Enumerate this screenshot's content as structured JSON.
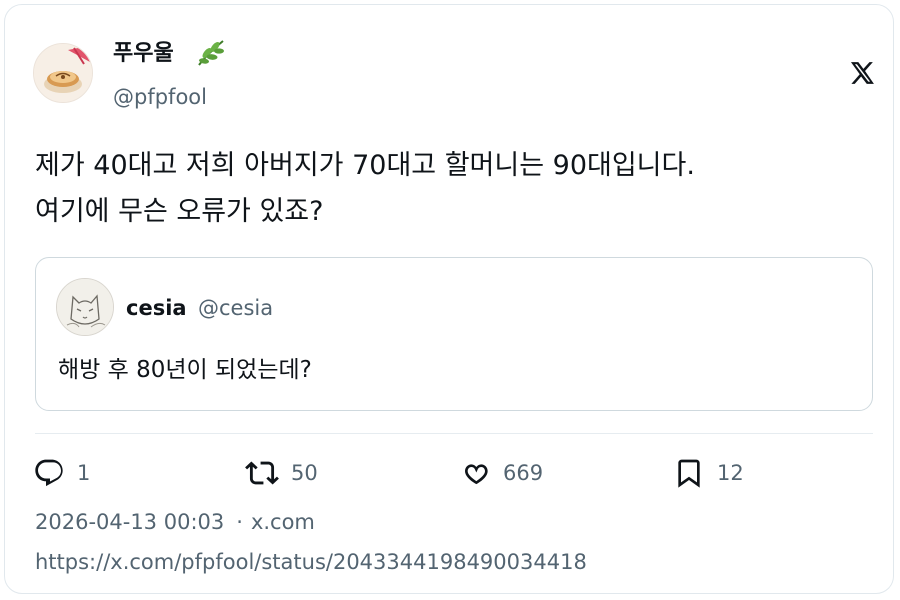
{
  "author": {
    "display_name": "푸우울",
    "handle": "@pfpfool"
  },
  "icons": {
    "profile_emoji": "leaf-icon",
    "brand": "x-logo-icon",
    "reply": "reply-icon",
    "retweet": "retweet-icon",
    "like": "heart-icon",
    "bookmark": "bookmark-icon"
  },
  "tweet": {
    "lines": [
      "제가 40대고 저희 아버지가 70대고 할머니는 90대입니다.",
      "여기에 무슨 오류가 있죠?"
    ]
  },
  "quoted_tweet": {
    "display_name": "cesia",
    "handle": "@cesia",
    "text": "해방 후 80년이 되었는데?"
  },
  "actions": {
    "replies": "1",
    "retweets": "50",
    "likes": "669",
    "bookmarks": "12"
  },
  "meta": {
    "timestamp": "2026-04-13 00:03",
    "separator": "·",
    "source": "x.com",
    "url": "https://x.com/pfpfool/status/2043344198490034418"
  },
  "colors": {
    "text": "#0f1419",
    "secondary": "#536471",
    "border": "#cfd9de",
    "leaf": "#5a9e3a"
  }
}
